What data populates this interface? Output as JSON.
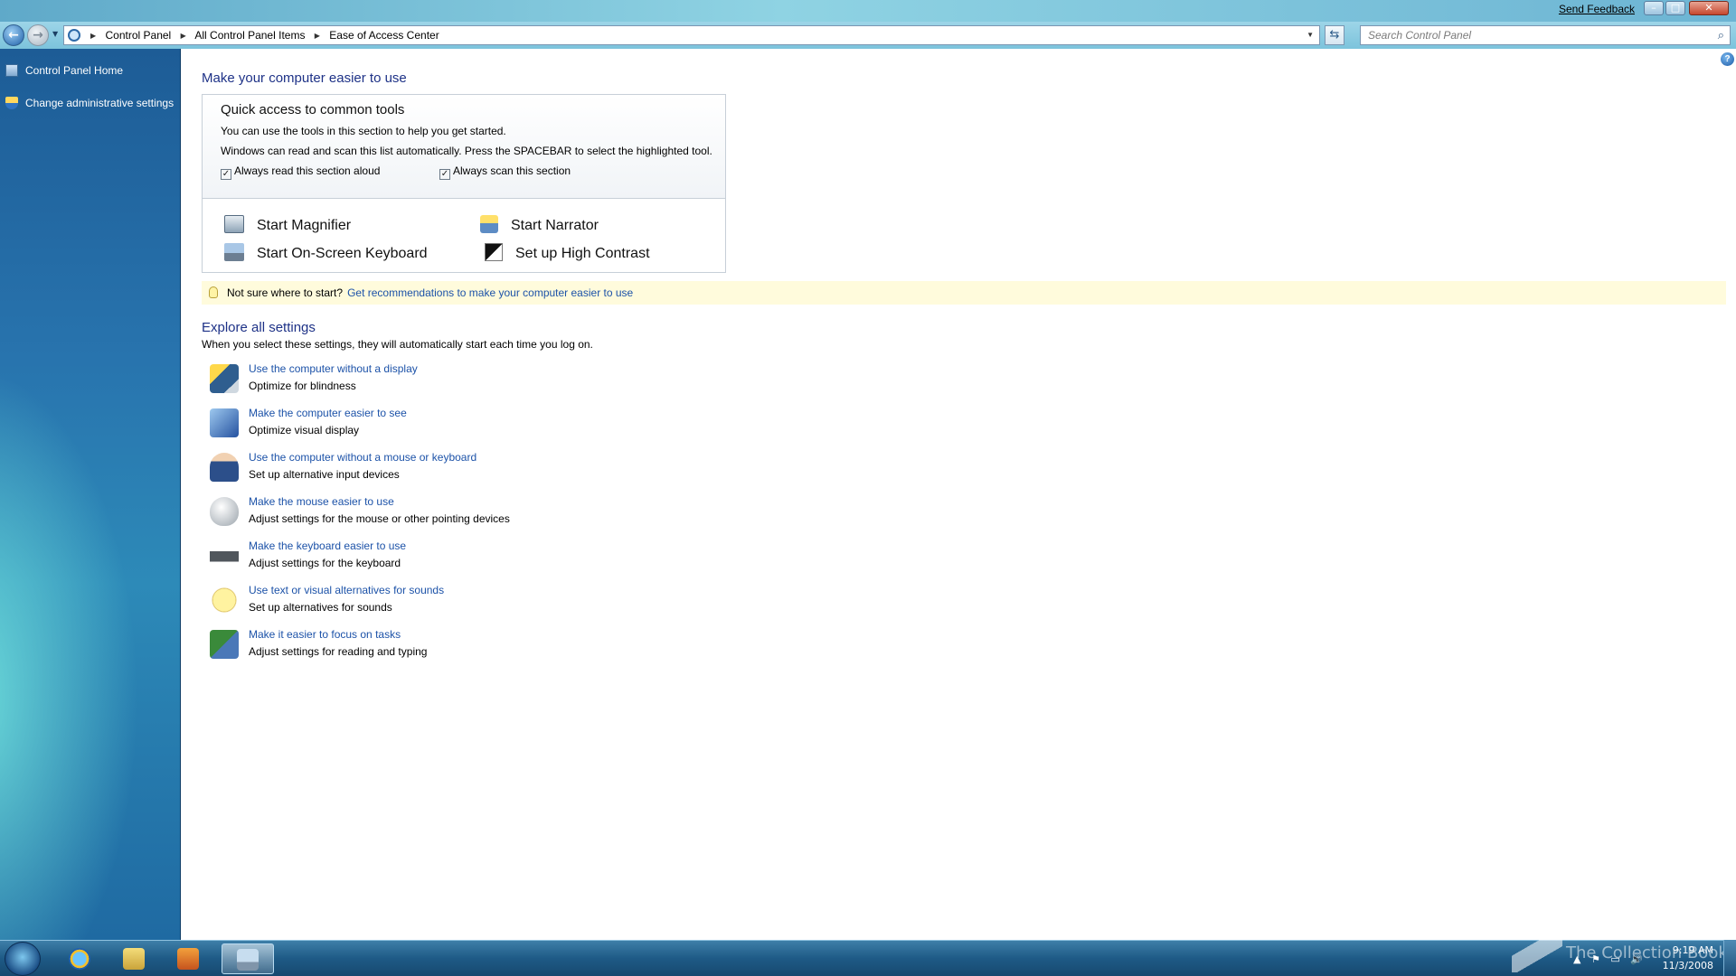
{
  "window": {
    "send_feedback": "Send Feedback",
    "min_glyph": "–",
    "max_glyph": "□",
    "close_glyph": "✕"
  },
  "address": {
    "back_glyph": "←",
    "forward_glyph": "→",
    "breadcrumbs": [
      "Control Panel",
      "All Control Panel Items",
      "Ease of Access Center"
    ],
    "separator": "▶",
    "dropdown_glyph": "▼",
    "refresh_glyph": "⇆",
    "search_placeholder": "Search Control Panel",
    "search_glyph": "⌕"
  },
  "sidebar": {
    "items": [
      {
        "label": "Control Panel Home",
        "icon": "control-panel-icon"
      },
      {
        "label": "Change administrative settings",
        "icon": "shield-icon"
      }
    ]
  },
  "main": {
    "help_glyph": "?",
    "title": "Make your computer easier to use",
    "quick_access": {
      "title": "Quick access to common tools",
      "line1": "You can use the tools in this section to help you get started.",
      "line2": "Windows can read and scan this list automatically.  Press the SPACEBAR to select the highlighted tool.",
      "check_read": {
        "label": "Always read this section aloud",
        "checked": true,
        "mark": "✓"
      },
      "check_scan": {
        "label": "Always scan this section",
        "checked": true,
        "mark": "✓"
      },
      "tools": {
        "magnifier": "Start Magnifier",
        "narrator": "Start Narrator",
        "keyboard": "Start On-Screen Keyboard",
        "contrast": "Set up High Contrast"
      }
    },
    "tip": {
      "text": "Not sure where to start?",
      "link": "Get recommendations to make your computer easier to use"
    },
    "explore": {
      "title": "Explore all settings",
      "subtitle": "When you select these settings, they will automatically start each time you log on.",
      "items": [
        {
          "link": "Use the computer without a display",
          "desc": "Optimize for blindness",
          "icon": "display-icon"
        },
        {
          "link": "Make the computer easier to see",
          "desc": "Optimize visual display",
          "icon": "monitor-icon"
        },
        {
          "link": "Use the computer without a mouse or keyboard",
          "desc": "Set up alternative input devices",
          "icon": "person-icon"
        },
        {
          "link": "Make the mouse easier to use",
          "desc": "Adjust settings for the mouse or other pointing devices",
          "icon": "mouse-icon"
        },
        {
          "link": "Make the keyboard easier to use",
          "desc": "Adjust settings for the keyboard",
          "icon": "keyboard-icon"
        },
        {
          "link": "Use text or visual alternatives for sounds",
          "desc": "Set up alternatives for sounds",
          "icon": "speech-bubble-icon"
        },
        {
          "link": "Make it easier to focus on tasks",
          "desc": "Adjust settings for reading and typing",
          "icon": "focus-icon"
        }
      ]
    }
  },
  "taskbar": {
    "watermark": "The Collection Book",
    "clock_time": "9:19 AM",
    "clock_date": "11/3/2008",
    "tray_glyphs": [
      "▲",
      "⚑",
      "▭",
      "🔊"
    ]
  }
}
